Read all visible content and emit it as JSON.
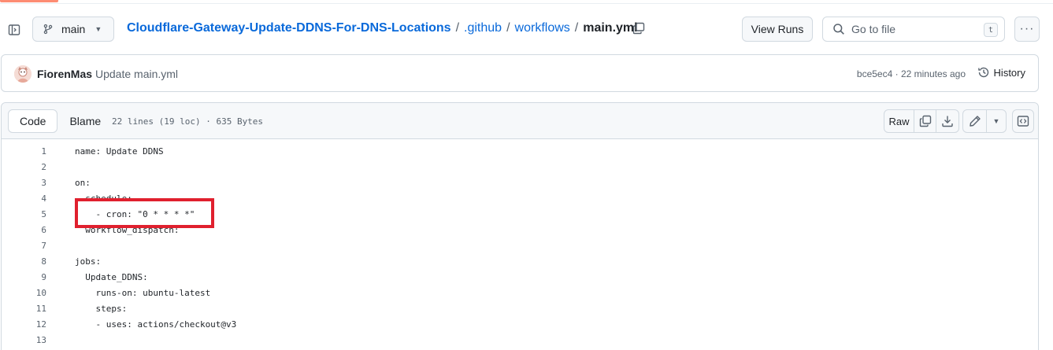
{
  "header": {
    "branch": "main",
    "breadcrumb": {
      "repo": "Cloudflare-Gateway-Update-DDNS-For-DNS-Locations",
      "sep": "/",
      "dir1": ".github",
      "dir2": "workflows",
      "file": "main.yml"
    },
    "view_runs_label": "View Runs",
    "goto_placeholder": "Go to file",
    "goto_shortcut": "t",
    "more_label": "···"
  },
  "commit": {
    "author": "FiorenMas",
    "message": "Update main.yml",
    "meta": "bce5ec4 · 22 minutes ago",
    "history_label": "History"
  },
  "file": {
    "tabs": {
      "code": "Code",
      "blame": "Blame"
    },
    "info": "22 lines (19 loc) · 635 Bytes",
    "raw_label": "Raw",
    "lines": [
      {
        "n": "1",
        "text": "name: Update DDNS"
      },
      {
        "n": "2",
        "text": ""
      },
      {
        "n": "3",
        "text": "on:"
      },
      {
        "n": "4",
        "text": "  schedule:"
      },
      {
        "n": "5",
        "text": "    - cron: \"0 * * * *\""
      },
      {
        "n": "6",
        "text": "  workflow_dispatch:"
      },
      {
        "n": "7",
        "text": ""
      },
      {
        "n": "8",
        "text": "jobs:"
      },
      {
        "n": "9",
        "text": "  Update_DDNS:"
      },
      {
        "n": "10",
        "text": "    runs-on: ubuntu-latest"
      },
      {
        "n": "11",
        "text": "    steps:"
      },
      {
        "n": "12",
        "text": "    - uses: actions/checkout@v3"
      },
      {
        "n": "13",
        "text": ""
      }
    ]
  },
  "annotation": {
    "color": "#e0202e",
    "target_line": "5"
  },
  "colors": {
    "link": "#0969da",
    "border": "#d1d9e0",
    "muted": "#59636e",
    "accent": "#fd8c73"
  }
}
